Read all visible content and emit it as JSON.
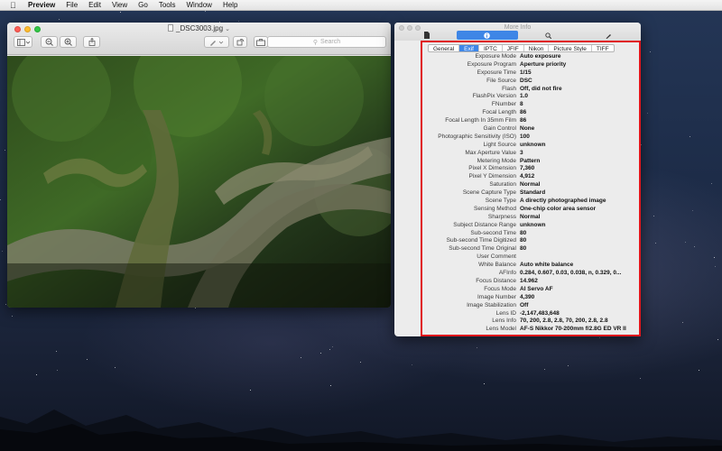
{
  "menubar": {
    "app_name": "Preview",
    "items": [
      "File",
      "Edit",
      "View",
      "Go",
      "Tools",
      "Window",
      "Help"
    ]
  },
  "preview": {
    "title": "_DSC3003.jpg",
    "search_placeholder": "Search"
  },
  "info": {
    "title": "More Info",
    "toolbar": [
      "document-icon",
      "info-icon",
      "search-icon",
      "pen-icon"
    ],
    "tabs": [
      {
        "label": "General",
        "selected": false
      },
      {
        "label": "Exif",
        "selected": true
      },
      {
        "label": "IPTC",
        "selected": false
      },
      {
        "label": "JFIF",
        "selected": false
      },
      {
        "label": "Nikon",
        "selected": false
      },
      {
        "label": "Picture Style",
        "selected": false
      },
      {
        "label": "TIFF",
        "selected": false
      }
    ],
    "rows": [
      {
        "key": "Exposure Mode",
        "value": "Auto exposure"
      },
      {
        "key": "Exposure Program",
        "value": "Aperture priority"
      },
      {
        "key": "Exposure Time",
        "value": "1/15"
      },
      {
        "key": "File Source",
        "value": "DSC"
      },
      {
        "key": "Flash",
        "value": "Off, did not fire"
      },
      {
        "key": "FlashPix Version",
        "value": "1.0"
      },
      {
        "key": "FNumber",
        "value": "8"
      },
      {
        "key": "Focal Length",
        "value": "86"
      },
      {
        "key": "Focal Length In 35mm Film",
        "value": "86"
      },
      {
        "key": "Gain Control",
        "value": "None"
      },
      {
        "key": "Photographic Sensitivity (ISO)",
        "value": "100"
      },
      {
        "key": "Light Source",
        "value": "unknown"
      },
      {
        "key": "Max Aperture Value",
        "value": "3"
      },
      {
        "key": "Metering Mode",
        "value": "Pattern"
      },
      {
        "key": "Pixel X Dimension",
        "value": "7,360"
      },
      {
        "key": "Pixel Y Dimension",
        "value": "4,912"
      },
      {
        "key": "Saturation",
        "value": "Normal"
      },
      {
        "key": "Scene Capture Type",
        "value": "Standard"
      },
      {
        "key": "Scene Type",
        "value": "A directly photographed image"
      },
      {
        "key": "Sensing Method",
        "value": "One-chip color area sensor"
      },
      {
        "key": "Sharpness",
        "value": "Normal"
      },
      {
        "key": "Subject Distance Range",
        "value": "unknown"
      },
      {
        "key": "Sub-second Time",
        "value": "80"
      },
      {
        "key": "Sub-second Time Digitized",
        "value": "80"
      },
      {
        "key": "Sub-second Time Original",
        "value": "80"
      },
      {
        "key": "User Comment",
        "value": ""
      },
      {
        "key": "White Balance",
        "value": "Auto white balance"
      },
      {
        "key": "AFInfo",
        "value": "0.284, 0.607, 0.03, 0.038, n, 0.329, 0..."
      },
      {
        "key": "Focus Distance",
        "value": "14.962"
      },
      {
        "key": "Focus Mode",
        "value": "AI Servo AF"
      },
      {
        "key": "Image Number",
        "value": "4,390"
      },
      {
        "key": "Image Stabilization",
        "value": "Off"
      },
      {
        "key": "Lens ID",
        "value": "-2,147,483,648"
      },
      {
        "key": "Lens Info",
        "value": "70, 200, 2.8, 2.8, 70, 200, 2.8, 2.8"
      },
      {
        "key": "Lens Model",
        "value": "AF-S Nikkor 70-200mm f/2.8G ED VR II"
      }
    ]
  },
  "colors": {
    "accent": "#3e86e6",
    "highlight": "#e0161c"
  }
}
